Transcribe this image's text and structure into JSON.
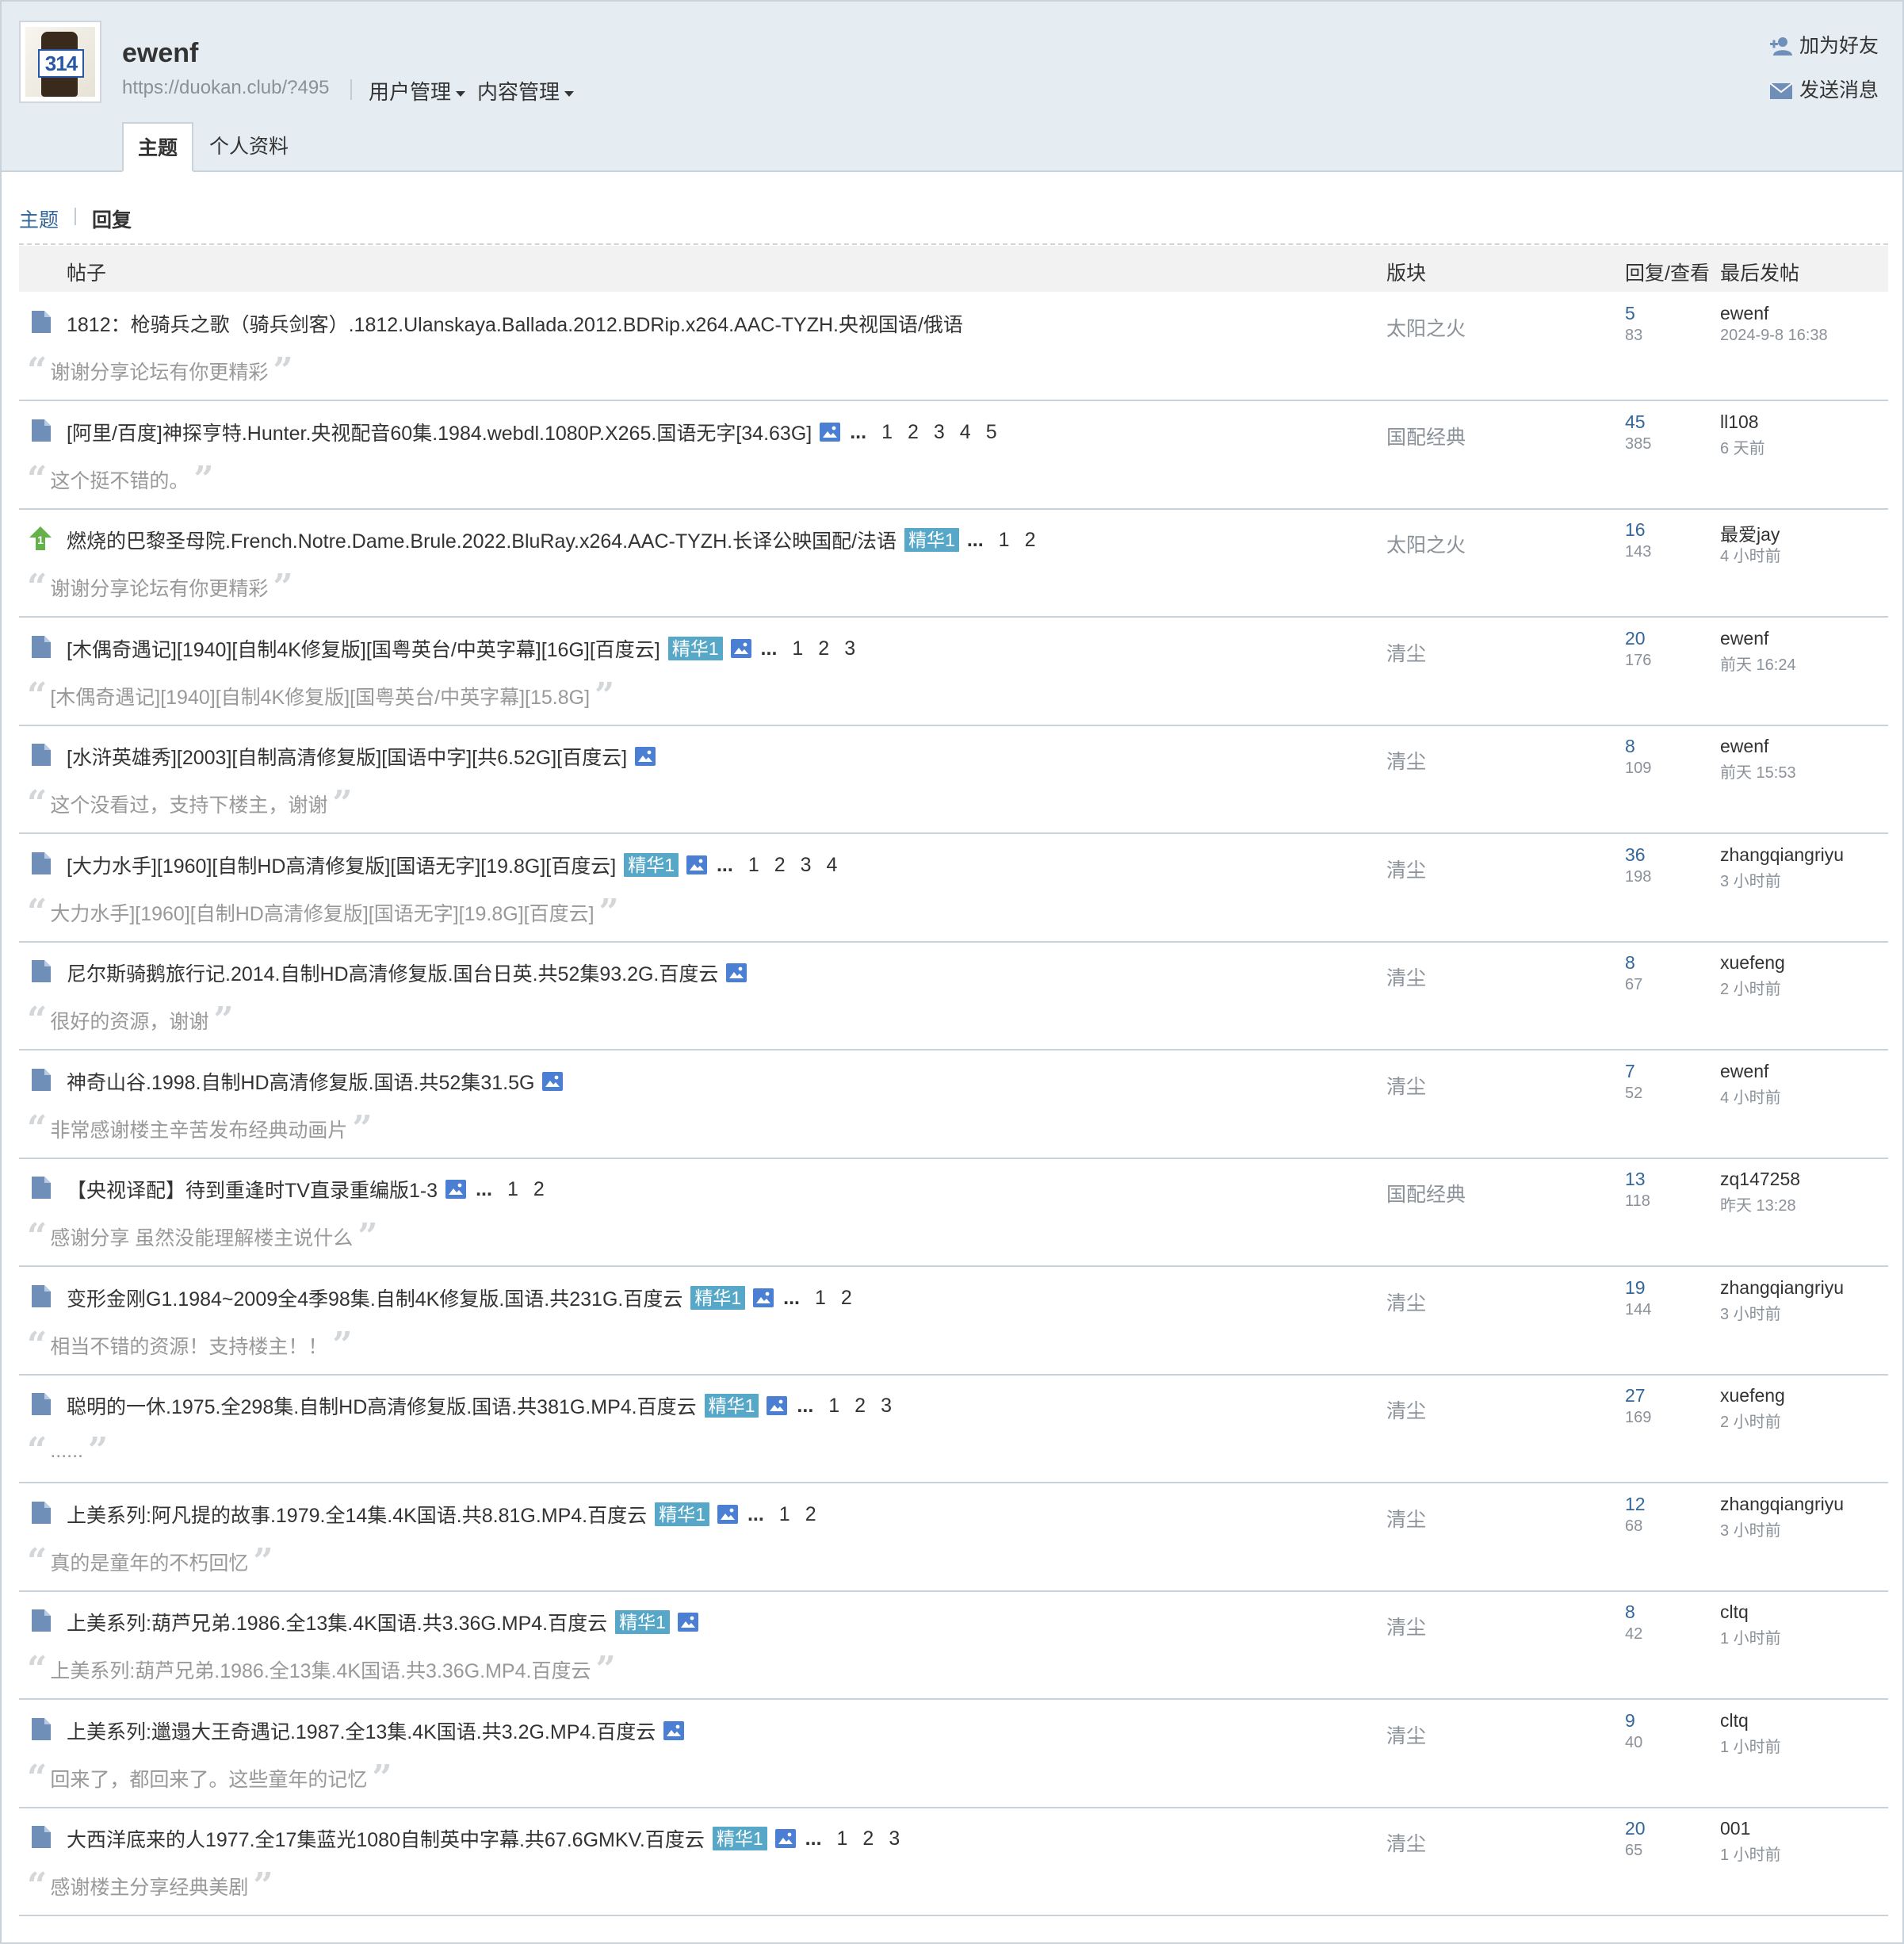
{
  "profile": {
    "username": "ewenf",
    "url": "https://duokan.club/?495",
    "avatar_label": "314",
    "menus": [
      "用户管理",
      "内容管理"
    ],
    "actions": {
      "add_friend": "加为好友",
      "send_message": "发送消息"
    },
    "tabs": [
      "主题",
      "个人资料"
    ]
  },
  "subtabs": {
    "topics": "主题",
    "replies": "回复"
  },
  "table_headers": {
    "post": "帖子",
    "forum": "版块",
    "stats": "回复/查看",
    "last": "最后发帖"
  },
  "labels": {
    "digest": "精华1",
    "ellipsis": "..."
  },
  "colors": {
    "link": "#336699",
    "badge": "#57a8c8",
    "header_bg": "#e5edf2",
    "icon_blue": "#4a7fd4"
  },
  "rows": [
    {
      "icon": "document-icon",
      "title": "1812：枪骑兵之歌（骑兵剑客）.1812.Ulanskaya.Ballada.2012.BDRip.x264.AAC-TYZH.央视国语/俄语",
      "digest": false,
      "image": false,
      "pages": [],
      "forum": "太阳之火",
      "replies": "5",
      "views": "83",
      "last_user": "ewenf",
      "last_time": "2024-9-8 16:38",
      "quote": "谢谢分享论坛有你更精彩"
    },
    {
      "icon": "document-icon",
      "title": "[阿里/百度]神探亨特.Hunter.央视配音60集.1984.webdl.1080P.X265.国语无字[34.63G]",
      "digest": false,
      "image": true,
      "pages": [
        "1",
        "2",
        "3",
        "4",
        "5"
      ],
      "forum": "国配经典",
      "replies": "45",
      "views": "385",
      "last_user": "ll108",
      "last_time": "6 天前",
      "quote": "这个挺不错的。"
    },
    {
      "icon": "upvote-icon",
      "title": "燃烧的巴黎圣母院.French.Notre.Dame.Brule.2022.BluRay.x264.AAC-TYZH.长译公映国配/法语",
      "digest": true,
      "image": false,
      "pages": [
        "1",
        "2"
      ],
      "forum": "太阳之火",
      "replies": "16",
      "views": "143",
      "last_user": "最爱jay",
      "last_time": "4 小时前",
      "quote": "谢谢分享论坛有你更精彩"
    },
    {
      "icon": "document-icon",
      "title": "[木偶奇遇记][1940][自制4K修复版][国粤英台/中英字幕][16G][百度云]",
      "digest": true,
      "image": true,
      "pages": [
        "1",
        "2",
        "3"
      ],
      "forum": "清尘",
      "replies": "20",
      "views": "176",
      "last_user": "ewenf",
      "last_time": "前天 16:24",
      "quote": "[木偶奇遇记][1940][自制4K修复版][国粤英台/中英字幕][15.8G]"
    },
    {
      "icon": "document-icon",
      "title": "[水浒英雄秀][2003][自制高清修复版][国语中字][共6.52G][百度云]",
      "digest": false,
      "image": true,
      "pages": [],
      "forum": "清尘",
      "replies": "8",
      "views": "109",
      "last_user": "ewenf",
      "last_time": "前天 15:53",
      "quote": "这个没看过，支持下楼主，谢谢"
    },
    {
      "icon": "document-icon",
      "title": "[大力水手][1960][自制HD高清修复版][国语无字][19.8G][百度云]",
      "digest": true,
      "image": true,
      "pages": [
        "1",
        "2",
        "3",
        "4"
      ],
      "forum": "清尘",
      "replies": "36",
      "views": "198",
      "last_user": "zhangqiangriyu",
      "last_time": "3 小时前",
      "quote": "大力水手][1960][自制HD高清修复版][国语无字][19.8G][百度云]"
    },
    {
      "icon": "document-icon",
      "title": "尼尔斯骑鹅旅行记.2014.自制HD高清修复版.国台日英.共52集93.2G.百度云",
      "digest": false,
      "image": true,
      "pages": [],
      "forum": "清尘",
      "replies": "8",
      "views": "67",
      "last_user": "xuefeng",
      "last_time": "2 小时前",
      "quote": "很好的资源，谢谢"
    },
    {
      "icon": "document-icon",
      "title": "神奇山谷.1998.自制HD高清修复版.国语.共52集31.5G",
      "digest": false,
      "image": true,
      "pages": [],
      "forum": "清尘",
      "replies": "7",
      "views": "52",
      "last_user": "ewenf",
      "last_time": "4 小时前",
      "quote": "非常感谢楼主辛苦发布经典动画片"
    },
    {
      "icon": "document-icon",
      "title": "【央视译配】待到重逢时TV直录重编版1-3",
      "digest": false,
      "image": true,
      "pages": [
        "1",
        "2"
      ],
      "forum": "国配经典",
      "replies": "13",
      "views": "118",
      "last_user": "zq147258",
      "last_time": "昨天 13:28",
      "quote": "感谢分享 虽然没能理解楼主说什么"
    },
    {
      "icon": "document-icon",
      "title": "变形金刚G1.1984~2009全4季98集.自制4K修复版.国语.共231G.百度云",
      "digest": true,
      "image": true,
      "pages": [
        "1",
        "2"
      ],
      "forum": "清尘",
      "replies": "19",
      "views": "144",
      "last_user": "zhangqiangriyu",
      "last_time": "3 小时前",
      "quote": "相当不错的资源！支持楼主！！"
    },
    {
      "icon": "document-icon",
      "title": "聪明的一休.1975.全298集.自制HD高清修复版.国语.共381G.MP4.百度云",
      "digest": true,
      "image": true,
      "pages": [
        "1",
        "2",
        "3"
      ],
      "forum": "清尘",
      "replies": "27",
      "views": "169",
      "last_user": "xuefeng",
      "last_time": "2 小时前",
      "quote": "......"
    },
    {
      "icon": "document-icon",
      "title": "上美系列:阿凡提的故事.1979.全14集.4K国语.共8.81G.MP4.百度云",
      "digest": true,
      "image": true,
      "pages": [
        "1",
        "2"
      ],
      "forum": "清尘",
      "replies": "12",
      "views": "68",
      "last_user": "zhangqiangriyu",
      "last_time": "3 小时前",
      "quote": "真的是童年的不朽回忆"
    },
    {
      "icon": "document-icon",
      "title": "上美系列:葫芦兄弟.1986.全13集.4K国语.共3.36G.MP4.百度云",
      "digest": true,
      "image": true,
      "pages": [],
      "forum": "清尘",
      "replies": "8",
      "views": "42",
      "last_user": "cltq",
      "last_time": "1 小时前",
      "quote": "上美系列:葫芦兄弟.1986.全13集.4K国语.共3.36G.MP4.百度云"
    },
    {
      "icon": "document-icon",
      "title": "上美系列:邋遢大王奇遇记.1987.全13集.4K国语.共3.2G.MP4.百度云",
      "digest": false,
      "image": true,
      "pages": [],
      "forum": "清尘",
      "replies": "9",
      "views": "40",
      "last_user": "cltq",
      "last_time": "1 小时前",
      "quote": "回来了，都回来了。这些童年的记忆"
    },
    {
      "icon": "document-icon",
      "title": "大西洋底来的人1977.全17集蓝光1080自制英中字幕.共67.6GMKV.百度云",
      "digest": true,
      "image": true,
      "pages": [
        "1",
        "2",
        "3"
      ],
      "forum": "清尘",
      "replies": "20",
      "views": "65",
      "last_user": "001",
      "last_time": "1 小时前",
      "quote": "感谢楼主分享经典美剧"
    }
  ]
}
